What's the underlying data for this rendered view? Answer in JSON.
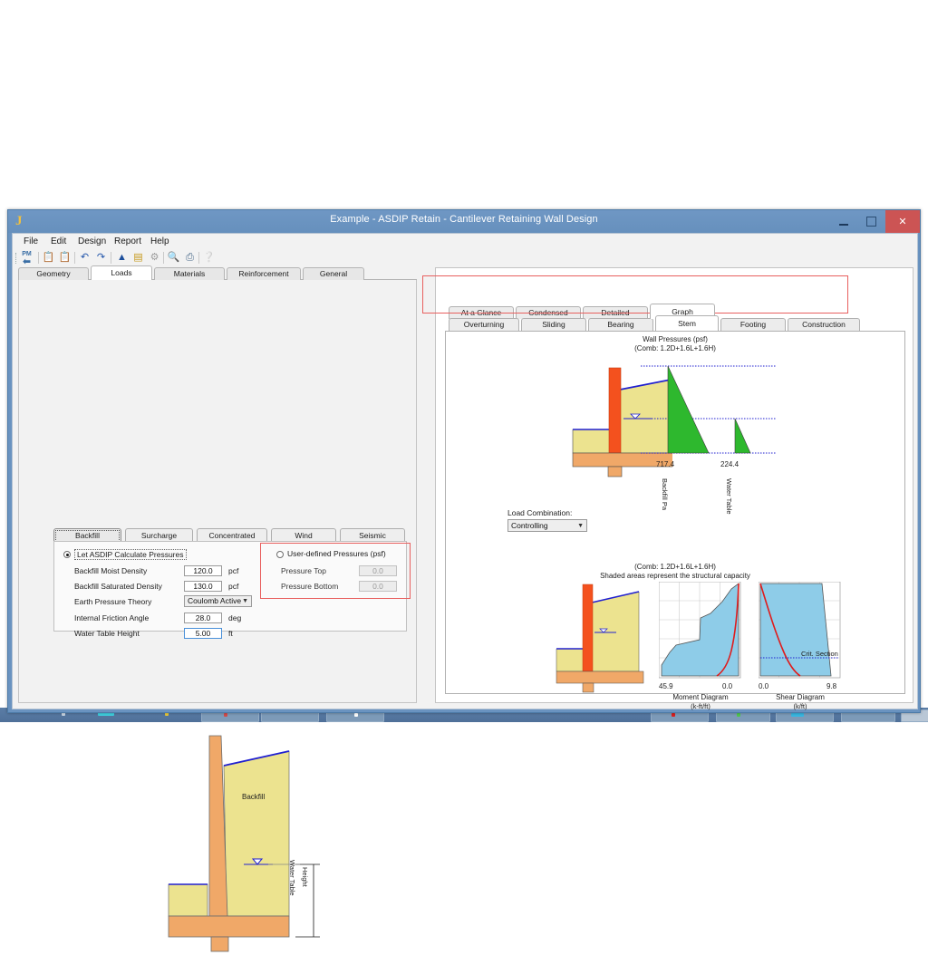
{
  "window": {
    "title": "Example - ASDIP Retain - Cantilever Retaining Wall Design",
    "app_icon": "J",
    "minimize_label": "Minimize",
    "maximize_label": "Maximize",
    "close_label": "✕"
  },
  "menu": {
    "items": [
      "File",
      "Edit",
      "Design",
      "Report",
      "Help"
    ]
  },
  "toolbar": {
    "icons": [
      "pm-back-icon",
      "copy-icon",
      "paste-icon",
      "undo-icon",
      "redo-icon",
      "analysis-icon",
      "print-preview-icon",
      "settings-icon",
      "zoom-icon",
      "print-icon",
      "help-icon"
    ]
  },
  "main_tabs": {
    "items": [
      "Geometry",
      "Loads",
      "Materials",
      "Reinforcement",
      "General"
    ],
    "selected": "Loads"
  },
  "load_tabs": {
    "items": [
      "Backfill",
      "Surcharge",
      "Concentrated",
      "Wind",
      "Seismic"
    ],
    "selected": "Backfill"
  },
  "backfill_form": {
    "calc_radio_label": "Let ASDIP Calculate Pressures",
    "calc_radio_selected": true,
    "user_radio_label": "User-defined Pressures (psf)",
    "user_radio_selected": false,
    "fields": [
      {
        "label": "Backfill Moist Density",
        "value": "120.0",
        "unit": "pcf"
      },
      {
        "label": "Backfill Saturated Density",
        "value": "130.0",
        "unit": "pcf"
      },
      {
        "label": "Internal Friction Angle",
        "value": "28.0",
        "unit": "deg"
      },
      {
        "label": "Water Table Height",
        "value": "5.00",
        "unit": "ft"
      }
    ],
    "theory_label": "Earth Pressure Theory",
    "theory_value": "Coulomb Active",
    "pressure_top_label": "Pressure Top",
    "pressure_top_value": "0.0",
    "pressure_bottom_label": "Pressure Bottom",
    "pressure_bottom_value": "0.0"
  },
  "left_drawing": {
    "backfill_label": "Backfill",
    "dim_label_1": "Water Table",
    "dim_label_2": "Height"
  },
  "result_tabs": {
    "items": [
      "At a Glance",
      "Condensed",
      "Detailed",
      "Graph"
    ],
    "selected": "Graph"
  },
  "graph_tabs": {
    "items": [
      "Overturning",
      "Sliding",
      "Bearing",
      "Stem",
      "Footing",
      "Construction"
    ],
    "selected": "Stem"
  },
  "load_combination": {
    "label": "Load Combination:",
    "value": "Controlling"
  },
  "chart_data": [
    {
      "type": "area",
      "title": "Wall Pressures (psf)",
      "subtitle": "(Comb: 1.2D+1.6L+1.6H)",
      "series": [
        {
          "name": "Backfill Pa",
          "peak_value": 717.4,
          "label": "717.4",
          "shape": "triangle",
          "fill": "#2eb82e",
          "from_top": true
        },
        {
          "name": "Water Table",
          "peak_value": 224.4,
          "label": "224.4",
          "shape": "triangle",
          "fill": "#2eb82e",
          "from_top": false
        }
      ],
      "axis_labels": [
        "Backfill Pa",
        "Water Table"
      ],
      "value_labels": [
        "717.4",
        "224.4"
      ]
    },
    {
      "type": "area",
      "title": "(Comb: 1.2D+1.6L+1.6H)",
      "subtitle": "Shaded areas represent the structural capacity",
      "xlabel": "Moment Diagram",
      "xunits": "(k-ft/ft)",
      "x_left_label": "45.9",
      "x_right_label": "0.0",
      "capacity_fill": "#8ecce8",
      "demand_color": "#e01b1b",
      "grid": true
    },
    {
      "type": "area",
      "xlabel": "Shear Diagram",
      "xunits": "(k/ft)",
      "x_left_label": "0.0",
      "x_right_label": "9.8",
      "annotation": "Crit. Section",
      "capacity_fill": "#8ecce8",
      "demand_color": "#e01b1b",
      "grid": true
    }
  ],
  "colors": {
    "title_bar": "#6a93c0",
    "close_button": "#cc5454",
    "highlight_box": "#e8605f",
    "soil": "#ece38f",
    "concrete": "#f0a868",
    "stem_hilite": "#f4511e",
    "water_line": "#2020d0",
    "pressure_green": "#2eb82e",
    "capacity_blue": "#8ecce8",
    "demand_red": "#e01b1b"
  }
}
